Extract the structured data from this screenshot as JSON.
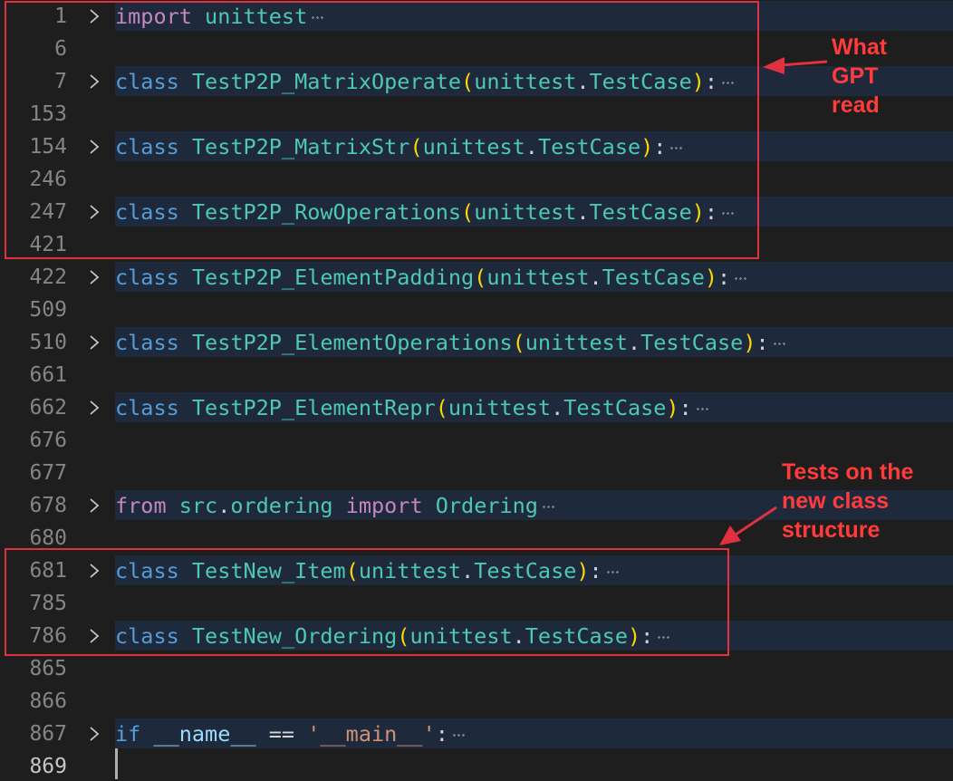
{
  "colors": {
    "background": "#1e1e1e",
    "line_highlight": "#1e2a3b",
    "annotation_red": "#e0313f",
    "keyword_purple": "#c586c0",
    "keyword_blue": "#569cd6",
    "class_teal": "#4ec9b0",
    "bracket_yellow": "#ffd700",
    "string_orange": "#ce9178"
  },
  "lines": [
    {
      "num": "1",
      "folded": true,
      "tokens": [
        {
          "t": "kw",
          "v": "import"
        },
        {
          "t": "punc",
          "v": " "
        },
        {
          "t": "mod",
          "v": "unittest"
        }
      ]
    },
    {
      "num": "6",
      "folded": false,
      "tokens": []
    },
    {
      "num": "7",
      "folded": true,
      "tokens": [
        {
          "t": "kwb",
          "v": "class"
        },
        {
          "t": "punc",
          "v": " "
        },
        {
          "t": "cls",
          "v": "TestP2P_MatrixOperate"
        },
        {
          "t": "brk",
          "v": "("
        },
        {
          "t": "mod",
          "v": "unittest"
        },
        {
          "t": "punc",
          "v": "."
        },
        {
          "t": "cls",
          "v": "TestCase"
        },
        {
          "t": "brk",
          "v": ")"
        },
        {
          "t": "punc",
          "v": ":"
        }
      ]
    },
    {
      "num": "153",
      "folded": false,
      "tokens": []
    },
    {
      "num": "154",
      "folded": true,
      "tokens": [
        {
          "t": "kwb",
          "v": "class"
        },
        {
          "t": "punc",
          "v": " "
        },
        {
          "t": "cls",
          "v": "TestP2P_MatrixStr"
        },
        {
          "t": "brk",
          "v": "("
        },
        {
          "t": "mod",
          "v": "unittest"
        },
        {
          "t": "punc",
          "v": "."
        },
        {
          "t": "cls",
          "v": "TestCase"
        },
        {
          "t": "brk",
          "v": ")"
        },
        {
          "t": "punc",
          "v": ":"
        }
      ]
    },
    {
      "num": "246",
      "folded": false,
      "tokens": []
    },
    {
      "num": "247",
      "folded": true,
      "tokens": [
        {
          "t": "kwb",
          "v": "class"
        },
        {
          "t": "punc",
          "v": " "
        },
        {
          "t": "cls",
          "v": "TestP2P_RowOperations"
        },
        {
          "t": "brk",
          "v": "("
        },
        {
          "t": "mod",
          "v": "unittest"
        },
        {
          "t": "punc",
          "v": "."
        },
        {
          "t": "cls",
          "v": "TestCase"
        },
        {
          "t": "brk",
          "v": ")"
        },
        {
          "t": "punc",
          "v": ":"
        }
      ]
    },
    {
      "num": "421",
      "folded": false,
      "tokens": []
    },
    {
      "num": "422",
      "folded": true,
      "tokens": [
        {
          "t": "kwb",
          "v": "class"
        },
        {
          "t": "punc",
          "v": " "
        },
        {
          "t": "cls",
          "v": "TestP2P_ElementPadding"
        },
        {
          "t": "brk",
          "v": "("
        },
        {
          "t": "mod",
          "v": "unittest"
        },
        {
          "t": "punc",
          "v": "."
        },
        {
          "t": "cls",
          "v": "TestCase"
        },
        {
          "t": "brk",
          "v": ")"
        },
        {
          "t": "punc",
          "v": ":"
        }
      ]
    },
    {
      "num": "509",
      "folded": false,
      "tokens": []
    },
    {
      "num": "510",
      "folded": true,
      "tokens": [
        {
          "t": "kwb",
          "v": "class"
        },
        {
          "t": "punc",
          "v": " "
        },
        {
          "t": "cls",
          "v": "TestP2P_ElementOperations"
        },
        {
          "t": "brk",
          "v": "("
        },
        {
          "t": "mod",
          "v": "unittest"
        },
        {
          "t": "punc",
          "v": "."
        },
        {
          "t": "cls",
          "v": "TestCase"
        },
        {
          "t": "brk",
          "v": ")"
        },
        {
          "t": "punc",
          "v": ":"
        }
      ]
    },
    {
      "num": "661",
      "folded": false,
      "tokens": []
    },
    {
      "num": "662",
      "folded": true,
      "tokens": [
        {
          "t": "kwb",
          "v": "class"
        },
        {
          "t": "punc",
          "v": " "
        },
        {
          "t": "cls",
          "v": "TestP2P_ElementRepr"
        },
        {
          "t": "brk",
          "v": "("
        },
        {
          "t": "mod",
          "v": "unittest"
        },
        {
          "t": "punc",
          "v": "."
        },
        {
          "t": "cls",
          "v": "TestCase"
        },
        {
          "t": "brk",
          "v": ")"
        },
        {
          "t": "punc",
          "v": ":"
        }
      ]
    },
    {
      "num": "676",
      "folded": false,
      "tokens": []
    },
    {
      "num": "677",
      "folded": false,
      "tokens": []
    },
    {
      "num": "678",
      "folded": true,
      "tokens": [
        {
          "t": "kw",
          "v": "from"
        },
        {
          "t": "punc",
          "v": " "
        },
        {
          "t": "mod",
          "v": "src"
        },
        {
          "t": "punc",
          "v": "."
        },
        {
          "t": "mod",
          "v": "ordering"
        },
        {
          "t": "punc",
          "v": " "
        },
        {
          "t": "kw",
          "v": "import"
        },
        {
          "t": "punc",
          "v": " "
        },
        {
          "t": "cls",
          "v": "Ordering"
        }
      ]
    },
    {
      "num": "680",
      "folded": false,
      "tokens": []
    },
    {
      "num": "681",
      "folded": true,
      "tokens": [
        {
          "t": "kwb",
          "v": "class"
        },
        {
          "t": "punc",
          "v": " "
        },
        {
          "t": "cls",
          "v": "TestNew_Item"
        },
        {
          "t": "brk",
          "v": "("
        },
        {
          "t": "mod",
          "v": "unittest"
        },
        {
          "t": "punc",
          "v": "."
        },
        {
          "t": "cls",
          "v": "TestCase"
        },
        {
          "t": "brk",
          "v": ")"
        },
        {
          "t": "punc",
          "v": ":"
        }
      ]
    },
    {
      "num": "785",
      "folded": false,
      "tokens": []
    },
    {
      "num": "786",
      "folded": true,
      "tokens": [
        {
          "t": "kwb",
          "v": "class"
        },
        {
          "t": "punc",
          "v": " "
        },
        {
          "t": "cls",
          "v": "TestNew_Ordering"
        },
        {
          "t": "brk",
          "v": "("
        },
        {
          "t": "mod",
          "v": "unittest"
        },
        {
          "t": "punc",
          "v": "."
        },
        {
          "t": "cls",
          "v": "TestCase"
        },
        {
          "t": "brk",
          "v": ")"
        },
        {
          "t": "punc",
          "v": ":"
        }
      ]
    },
    {
      "num": "865",
      "folded": false,
      "tokens": []
    },
    {
      "num": "866",
      "folded": false,
      "tokens": []
    },
    {
      "num": "867",
      "folded": true,
      "tokens": [
        {
          "t": "kwb",
          "v": "if"
        },
        {
          "t": "punc",
          "v": " "
        },
        {
          "t": "var",
          "v": "__name__"
        },
        {
          "t": "punc",
          "v": " == "
        },
        {
          "t": "str",
          "v": "'__main__'"
        },
        {
          "t": "punc",
          "v": ":"
        }
      ]
    },
    {
      "num": "869",
      "folded": false,
      "active": true,
      "tokens": []
    }
  ],
  "annotations": {
    "what_gpt_read": "What\nGPT\nread",
    "tests_new_structure": "Tests on the\nnew class\nstructure"
  }
}
